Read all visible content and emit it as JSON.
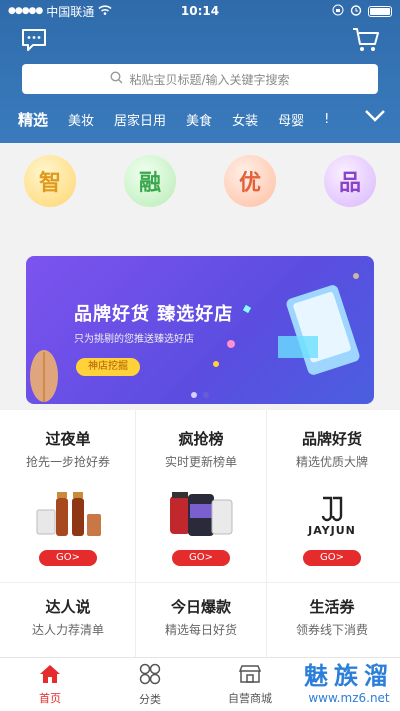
{
  "status_bar": {
    "carrier": "中国联通",
    "time": "10:14"
  },
  "search": {
    "placeholder": "粘贴宝贝标题/输入关键字搜索"
  },
  "tabs": [
    {
      "label": "精选"
    },
    {
      "label": "美妆"
    },
    {
      "label": "居家日用"
    },
    {
      "label": "美食"
    },
    {
      "label": "女装"
    },
    {
      "label": "母婴"
    },
    {
      "label": "!"
    }
  ],
  "categories": [
    {
      "label": "智"
    },
    {
      "label": "融"
    },
    {
      "label": "优"
    },
    {
      "label": "品"
    }
  ],
  "banner": {
    "title": "品牌好货 臻选好店",
    "subtitle": "只为挑剔的您推送臻选好店",
    "button": "神店挖掘"
  },
  "products": [
    {
      "title": "过夜单",
      "sub": "抢先一步抢好券",
      "go": "GO>"
    },
    {
      "title": "疯抢榜",
      "sub": "实时更新榜单",
      "go": "GO>"
    },
    {
      "title": "品牌好货",
      "sub": "精选优质大牌",
      "go": "GO>",
      "brand": "JAYJUN"
    },
    {
      "title": "达人说",
      "sub": "达人力荐清单"
    },
    {
      "title": "今日爆款",
      "sub": "精选每日好货"
    },
    {
      "title": "生活券",
      "sub": "领券线下消费"
    }
  ],
  "nav": [
    {
      "label": "首页"
    },
    {
      "label": "分类"
    },
    {
      "label": "自营商城"
    }
  ],
  "watermark": {
    "name": "魅族溜",
    "url": "www.mz6.net"
  },
  "colors": {
    "header": "#2f6bab",
    "accent": "#e52b2b"
  }
}
